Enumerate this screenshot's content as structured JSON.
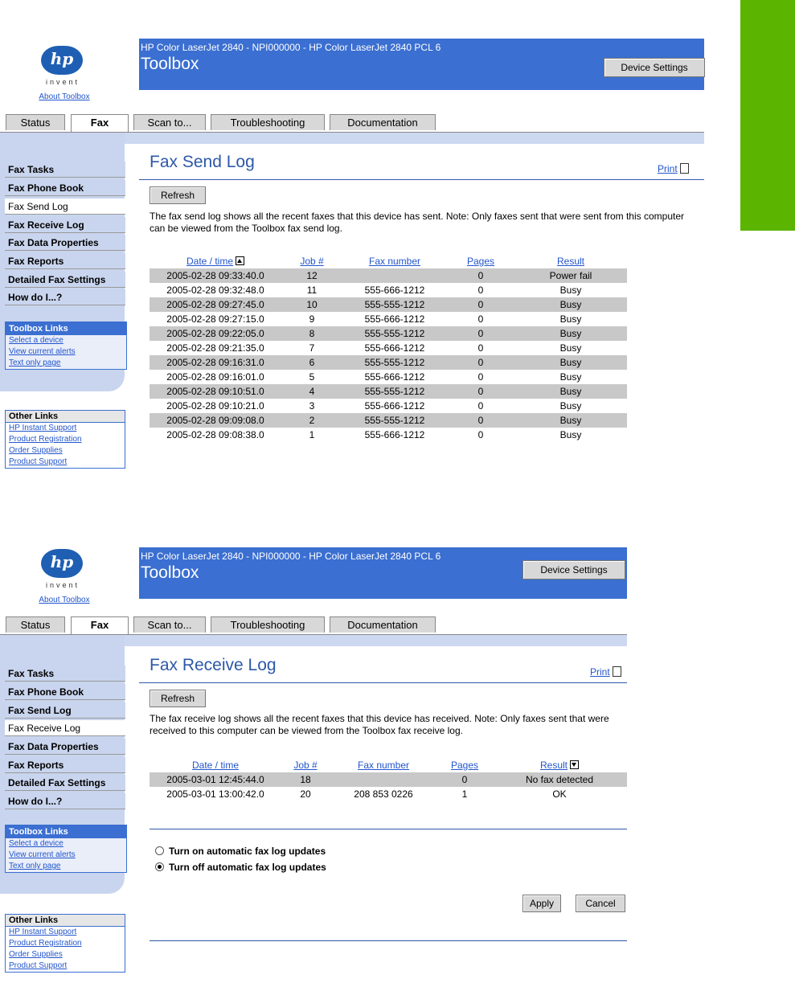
{
  "panel1": {
    "logo": {
      "mark": "hp",
      "tagline": "invent",
      "about": "About Toolbox"
    },
    "header": {
      "subtitle": "HP Color LaserJet 2840 - NPI000000 - HP Color LaserJet 2840 PCL 6",
      "title": "Toolbox",
      "device_settings": "Device Settings"
    },
    "tabs": [
      "Status",
      "Fax",
      "Scan to...",
      "Troubleshooting",
      "Documentation"
    ],
    "nav": [
      "Fax Tasks",
      "Fax Phone Book",
      "Fax Send Log",
      "Fax Receive Log",
      "Fax Data Properties",
      "Fax Reports",
      "Detailed Fax Settings",
      "How do I...?"
    ],
    "toolbox_links": {
      "header": "Toolbox Links",
      "items": [
        "Select a device",
        "View current alerts",
        "Text only page"
      ]
    },
    "other_links": {
      "header": "Other Links",
      "items": [
        "HP Instant Support",
        "Product Registration",
        "Order Supplies",
        "Product Support"
      ]
    },
    "page_title": "Fax Send Log",
    "print": "Print",
    "refresh": "Refresh",
    "description": "The fax send log shows all the recent faxes that this device has sent. Note: Only faxes sent that were sent from this computer can be viewed from the Toolbox fax send log.",
    "columns": [
      "Date / time",
      "Job #",
      "Fax number",
      "Pages",
      "Result"
    ],
    "rows": [
      [
        "2005-02-28 09:33:40.0",
        "12",
        "",
        "0",
        "Power fail"
      ],
      [
        "2005-02-28 09:32:48.0",
        "11",
        "555-666-1212",
        "0",
        "Busy"
      ],
      [
        "2005-02-28 09:27:45.0",
        "10",
        "555-555-1212",
        "0",
        "Busy"
      ],
      [
        "2005-02-28 09:27:15.0",
        "9",
        "555-666-1212",
        "0",
        "Busy"
      ],
      [
        "2005-02-28 09:22:05.0",
        "8",
        "555-555-1212",
        "0",
        "Busy"
      ],
      [
        "2005-02-28 09:21:35.0",
        "7",
        "555-666-1212",
        "0",
        "Busy"
      ],
      [
        "2005-02-28 09:16:31.0",
        "6",
        "555-555-1212",
        "0",
        "Busy"
      ],
      [
        "2005-02-28 09:16:01.0",
        "5",
        "555-666-1212",
        "0",
        "Busy"
      ],
      [
        "2005-02-28 09:10:51.0",
        "4",
        "555-555-1212",
        "0",
        "Busy"
      ],
      [
        "2005-02-28 09:10:21.0",
        "3",
        "555-666-1212",
        "0",
        "Busy"
      ],
      [
        "2005-02-28 09:09:08.0",
        "2",
        "555-555-1212",
        "0",
        "Busy"
      ],
      [
        "2005-02-28 09:08:38.0",
        "1",
        "555-666-1212",
        "0",
        "Busy"
      ]
    ]
  },
  "panel2": {
    "logo": {
      "mark": "hp",
      "tagline": "invent",
      "about": "About Toolbox"
    },
    "header": {
      "subtitle": "HP Color LaserJet 2840 - NPI000000 - HP Color LaserJet 2840 PCL 6",
      "title": "Toolbox",
      "device_settings": "Device Settings"
    },
    "tabs": [
      "Status",
      "Fax",
      "Scan to...",
      "Troubleshooting",
      "Documentation"
    ],
    "nav": [
      "Fax Tasks",
      "Fax Phone Book",
      "Fax Send Log",
      "Fax Receive Log",
      "Fax Data Properties",
      "Fax Reports",
      "Detailed Fax Settings",
      "How do I...?"
    ],
    "toolbox_links": {
      "header": "Toolbox Links",
      "items": [
        "Select a device",
        "View current alerts",
        "Text only page"
      ]
    },
    "other_links": {
      "header": "Other Links",
      "items": [
        "HP Instant Support",
        "Product Registration",
        "Order Supplies",
        "Product Support"
      ]
    },
    "page_title": "Fax Receive Log",
    "print": "Print",
    "refresh": "Refresh",
    "description": "The fax receive log shows all the recent faxes that this device has received. Note: Only faxes sent that were received to this computer can be viewed from the Toolbox fax receive log.",
    "columns": [
      "Date / time",
      "Job #",
      "Fax number",
      "Pages",
      "Result"
    ],
    "rows": [
      [
        "2005-03-01 12:45:44.0",
        "18",
        "",
        "0",
        "No fax detected"
      ],
      [
        "2005-03-01 13:00:42.0",
        "20",
        "208 853 0226",
        "1",
        "OK"
      ]
    ],
    "radio_on": "Turn on automatic fax log updates",
    "radio_off": "Turn off automatic fax log updates",
    "apply": "Apply",
    "cancel": "Cancel"
  },
  "colors": {
    "banner": "#3b6fd1",
    "accent_green": "#5bb400",
    "title_blue": "#2d58a8"
  }
}
